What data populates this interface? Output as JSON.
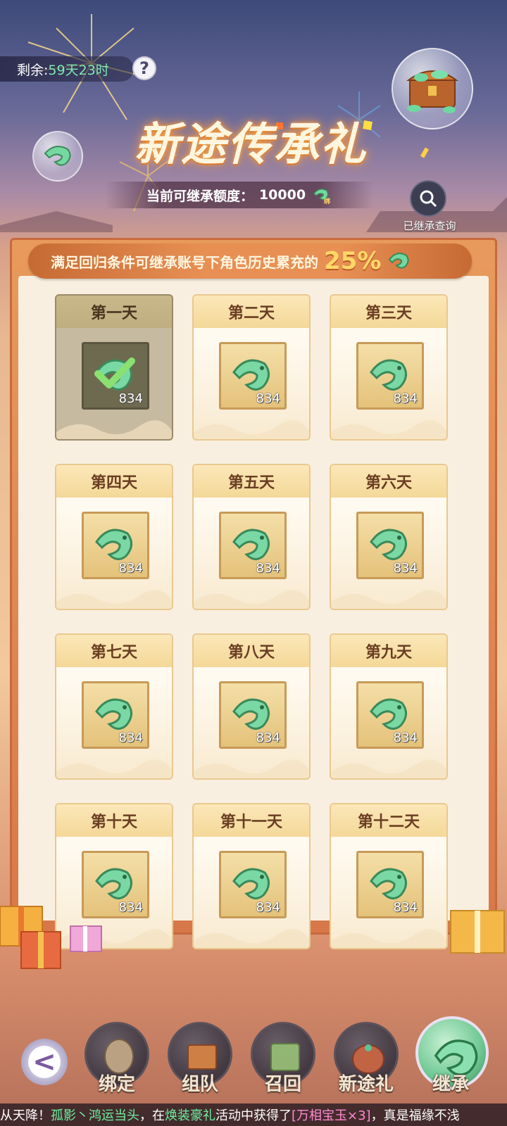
{
  "header": {
    "remaining_label": "剩余:",
    "remaining_value": "59天23时",
    "help": "?",
    "title": "新途传承礼",
    "quota_label": "当前可继承额度：",
    "quota_value": "10000",
    "bound_tag": "绑",
    "query_label": "已继承查询"
  },
  "banner": {
    "text": "满足回归条件可继承账号下角色历史累充的",
    "percent": "25%"
  },
  "days": [
    {
      "label": "第一天",
      "count": "834",
      "claimed": true
    },
    {
      "label": "第二天",
      "count": "834",
      "claimed": false
    },
    {
      "label": "第三天",
      "count": "834",
      "claimed": false
    },
    {
      "label": "第四天",
      "count": "834",
      "claimed": false
    },
    {
      "label": "第五天",
      "count": "834",
      "claimed": false
    },
    {
      "label": "第六天",
      "count": "834",
      "claimed": false
    },
    {
      "label": "第七天",
      "count": "834",
      "claimed": false
    },
    {
      "label": "第八天",
      "count": "834",
      "claimed": false
    },
    {
      "label": "第九天",
      "count": "834",
      "claimed": false
    },
    {
      "label": "第十天",
      "count": "834",
      "claimed": false
    },
    {
      "label": "第十一天",
      "count": "834",
      "claimed": false
    },
    {
      "label": "第十二天",
      "count": "834",
      "claimed": false
    }
  ],
  "nav": {
    "back": "<",
    "items": [
      {
        "label": "绑定",
        "icon": "glove-icon"
      },
      {
        "label": "组队",
        "icon": "chest-icon"
      },
      {
        "label": "召回",
        "icon": "scroll-icon"
      },
      {
        "label": "新途礼",
        "icon": "bag-icon"
      },
      {
        "label": "继承",
        "icon": "jade-icon",
        "active": true
      }
    ]
  },
  "ticker": {
    "prefix": "从天降！",
    "player": "孤影丶鸿运当头",
    "mid": "，在",
    "event": "焕装豪礼",
    "mid2": "活动中获得了",
    "item": "[万相宝玉×3]",
    "suffix": "，真是福缘不浅"
  },
  "colors": {
    "accent_green": "#7fe8b0",
    "panel_orange": "#e89a5c",
    "card_cream": "#fffaf0",
    "percent_yellow": "#ffd86a"
  }
}
